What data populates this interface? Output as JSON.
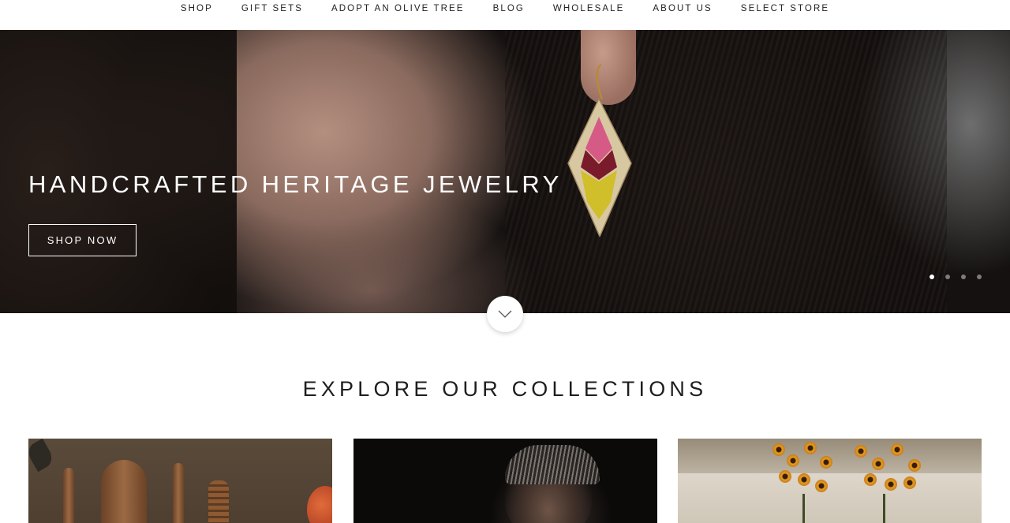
{
  "nav": {
    "items": [
      "SHOP",
      "GIFT SETS",
      "ADOPT AN OLIVE TREE",
      "BLOG",
      "WHOLESALE",
      "ABOUT US",
      "SELECT STORE"
    ]
  },
  "hero": {
    "title": "HANDCRAFTED HERITAGE JEWELRY",
    "cta_label": "SHOP NOW",
    "slide_count": 4,
    "active_slide": 1,
    "image": "woman-wearing-embroidered-diamond-earring"
  },
  "scroll_down": {
    "icon": "chevron-down-icon"
  },
  "collections": {
    "title": "EXPLORE OUR COLLECTIONS",
    "cards": [
      {
        "image": "olive-wood-kitchen-utensils"
      },
      {
        "image": "artisan-portrait-dark-background"
      },
      {
        "image": "orange-flower-bouquets-on-counter"
      }
    ]
  },
  "colors": {
    "background": "#ffffff",
    "text": "#1e1e1e",
    "hero_text": "#ffffff"
  }
}
